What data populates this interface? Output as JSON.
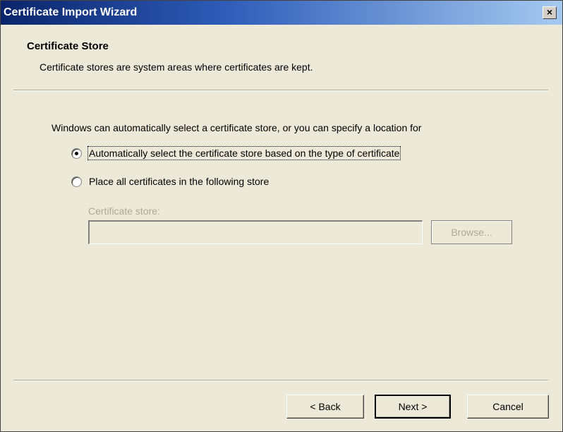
{
  "window": {
    "title": "Certificate Import Wizard",
    "close_label": "×"
  },
  "header": {
    "title": "Certificate Store",
    "subtitle": "Certificate stores are system areas where certificates are kept."
  },
  "body": {
    "intro": "Windows can automatically select a certificate store, or you can specify a location for",
    "options": [
      {
        "label": "Automatically select the certificate store based on the type of certificate",
        "selected": true
      },
      {
        "label": "Place all certificates in the following store",
        "selected": false
      }
    ],
    "store_label": "Certificate store:",
    "store_value": "",
    "browse_label": "Browse..."
  },
  "footer": {
    "back_label": "< Back",
    "next_label": "Next >",
    "cancel_label": "Cancel"
  }
}
